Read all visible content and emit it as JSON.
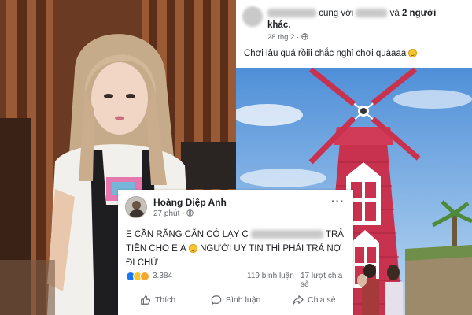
{
  "post_top": {
    "text_with": "cùng với",
    "text_and": "và",
    "others_count": "2 người",
    "others_suffix": "khác.",
    "date": "28 thg 2 ·",
    "status_text": "Chơi lâu quá rồiii chắc nghỉ chơi quáaaa"
  },
  "post_overlay": {
    "author": "Hoàng Diệp Anh",
    "time": "27 phút ·",
    "more": "···",
    "body_part1": "E CẦN RĂNG CĂN CÓ LẠY C",
    "body_part2": "TRẢ",
    "body_part3": "TIỀN CHO E Ạ",
    "body_part4": "NGƯỜI UY TIN THÌ PHẢI TRẢ NỢ",
    "body_part5": "ĐI CHỨ",
    "reaction_count": "3.384",
    "comments": "119 bình luận",
    "shares_sep": "·",
    "shares": "17 lượt chia sẻ",
    "like_label": "Thích",
    "comment_label": "Bình luận",
    "share_label": "Chia sẻ"
  },
  "colors": {
    "fb_blue": "#1877f2",
    "text_primary": "#1c1e21",
    "text_secondary": "#65676b",
    "windmill_red": "#c8324e"
  },
  "icons": {
    "globe": "globe-icon",
    "like": "like-icon",
    "comment": "comment-icon",
    "share": "share-icon"
  }
}
